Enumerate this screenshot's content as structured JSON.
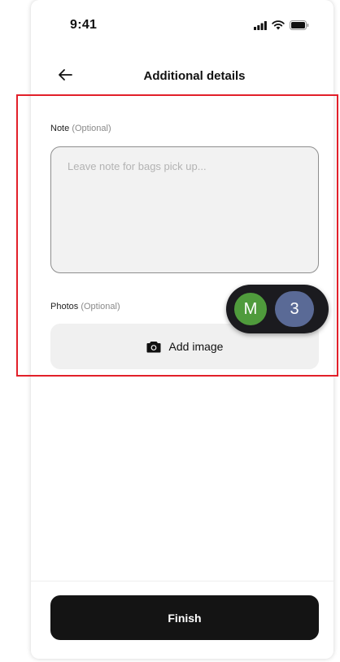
{
  "status_bar": {
    "time": "9:41",
    "icons": [
      "signal-icon",
      "wifi-icon",
      "battery-icon"
    ]
  },
  "header": {
    "title": "Additional details",
    "back_icon": "arrow-left-icon"
  },
  "note": {
    "label": "Note",
    "optional": "(Optional)",
    "placeholder": "Leave note for bags pick up...",
    "value": ""
  },
  "photos": {
    "label": "Photos",
    "optional": "(Optional)",
    "button_label": "Add image",
    "button_icon": "camera-icon"
  },
  "footer": {
    "finish_label": "Finish"
  },
  "presence": {
    "avatar_initial": "M",
    "count": "3"
  },
  "colors": {
    "highlight": "#e2202a",
    "primary_button": "#141414",
    "avatar_m": "#4f9b3c",
    "avatar_count": "#5a6a96"
  }
}
